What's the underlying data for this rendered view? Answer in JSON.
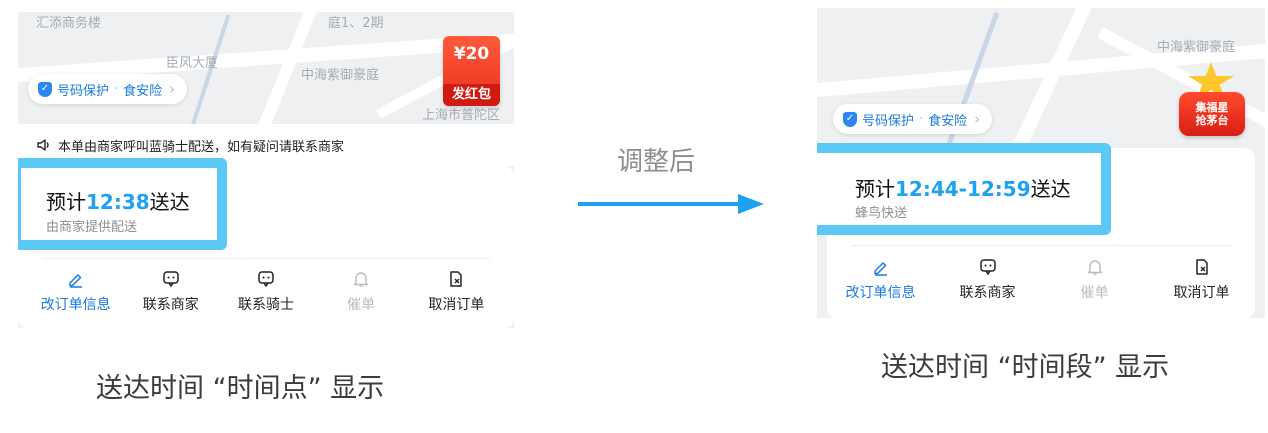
{
  "left": {
    "map_labels": [
      "汇添商务楼",
      "庭1、2期",
      "臣风大厦",
      "中海紫御豪庭",
      "上海市普陀区"
    ],
    "protection_pill": {
      "prefix": "号码保护",
      "sep": "·",
      "suffix": "食安险",
      "chevron": "›"
    },
    "red_packet": {
      "amount": "¥20",
      "label": "发红包"
    },
    "notice": {
      "text": "本单由商家呼叫蓝骑士配送，如有疑问请联系商家"
    },
    "eta": {
      "prefix": "预计",
      "time": "12:38",
      "suffix": "送达",
      "sub": "由商家提供配送"
    },
    "actions": [
      {
        "label": "改订单信息",
        "icon": "pen-icon"
      },
      {
        "label": "联系商家",
        "icon": "chat-icon"
      },
      {
        "label": "联系骑士",
        "icon": "chat-icon"
      },
      {
        "label": "催单",
        "icon": "bell-icon"
      },
      {
        "label": "取消订单",
        "icon": "cancel-doc-icon"
      }
    ]
  },
  "right": {
    "map_labels": [
      "中海紫御豪庭"
    ],
    "protection_pill": {
      "prefix": "号码保护",
      "sep": "·",
      "suffix": "食安险",
      "chevron": "›"
    },
    "star_badge": {
      "line1": "集福星",
      "line2": "抢茅台"
    },
    "eta": {
      "prefix": "预计",
      "time": "12:44-12:59",
      "suffix": "送达",
      "sub": "蜂鸟快送"
    },
    "actions": [
      {
        "label": "改订单信息",
        "icon": "pen-icon"
      },
      {
        "label": "联系商家",
        "icon": "chat-icon"
      },
      {
        "label": "催单",
        "icon": "bell-icon"
      },
      {
        "label": "取消订单",
        "icon": "cancel-doc-icon"
      }
    ]
  },
  "arrow_label": "调整后",
  "captions": {
    "left": "送达时间 “时间点” 显示",
    "right": "送达时间 “时间段” 显示"
  },
  "colors": {
    "highlight": "#5cc8f5",
    "arrow": "#1da1f2",
    "time": "#1da1f2",
    "link": "#1a7be0"
  }
}
